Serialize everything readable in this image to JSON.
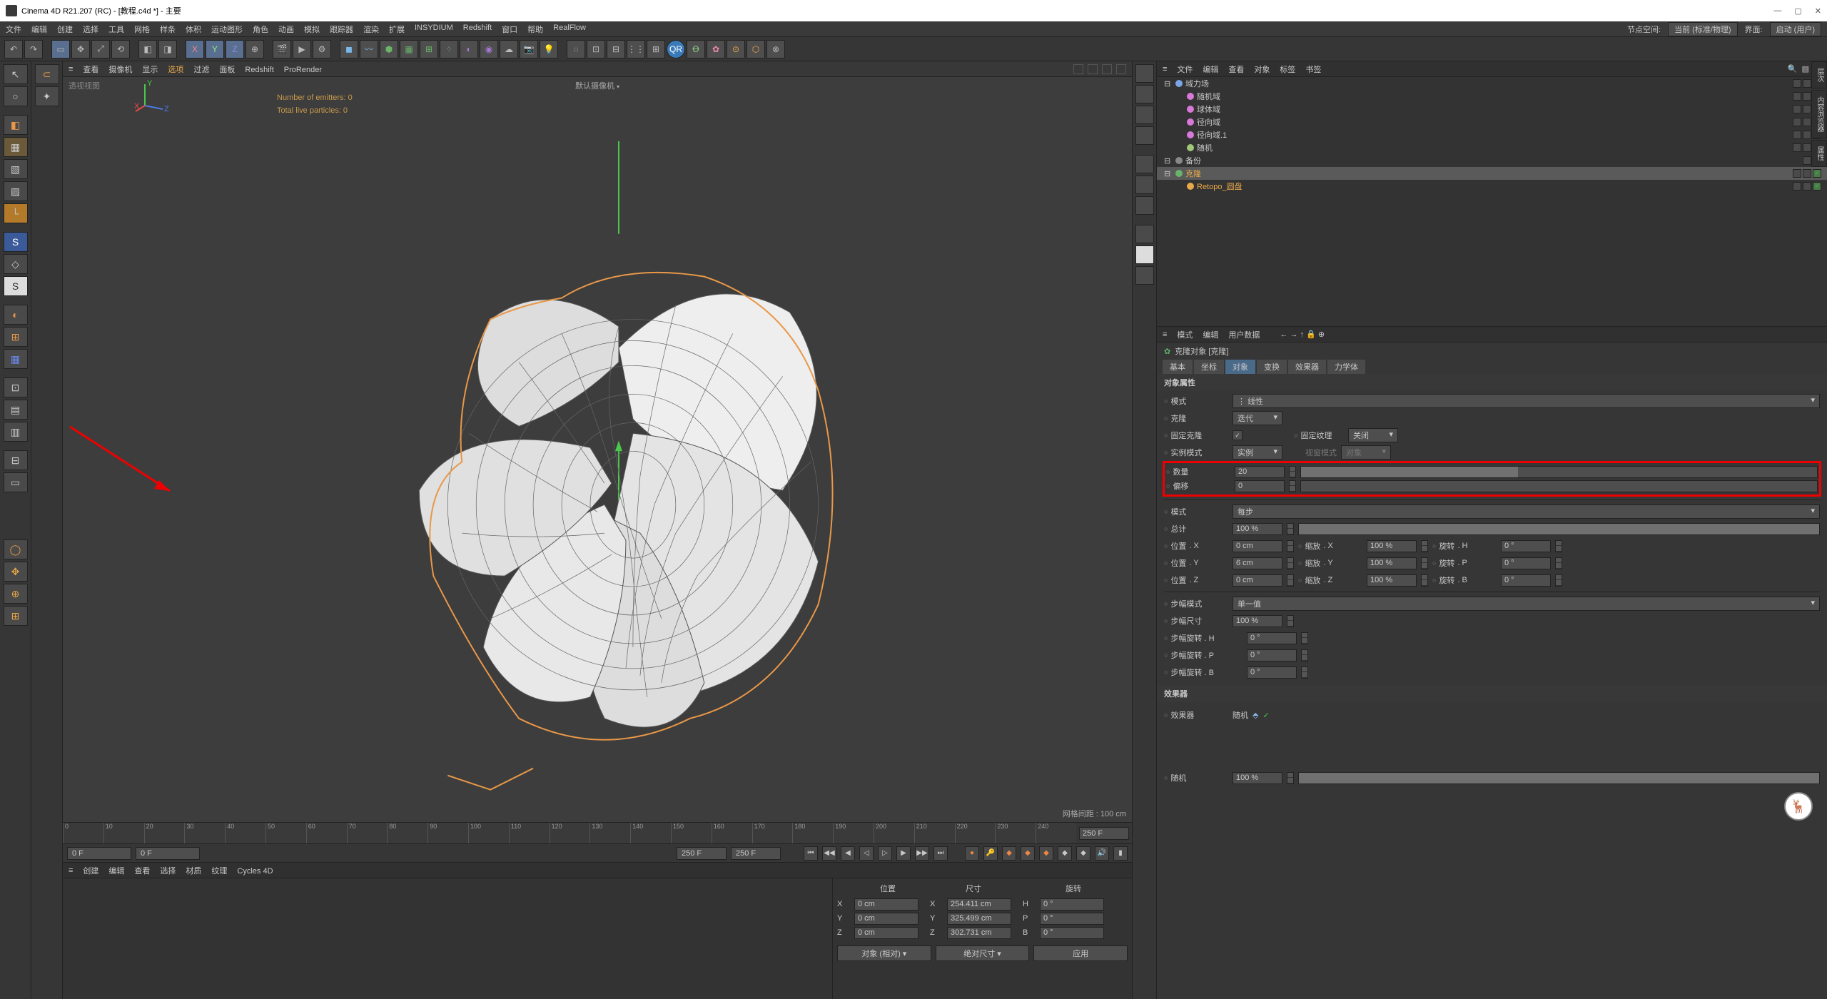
{
  "app": {
    "title": "Cinema 4D R21.207 (RC) - [教程.c4d *] - 主要",
    "node_space_label": "节点空间:",
    "node_space_value": "当前 (标准/物理)",
    "layout_label": "界面:",
    "layout_value": "启动 (用户)"
  },
  "menu": {
    "items": [
      "文件",
      "编辑",
      "创建",
      "选择",
      "工具",
      "网格",
      "样条",
      "体积",
      "运动图形",
      "角色",
      "动画",
      "模拟",
      "跟踪器",
      "渲染",
      "扩展",
      "INSYDIUM",
      "Redshift",
      "窗口",
      "帮助",
      "RealFlow"
    ]
  },
  "viewbar": {
    "items": [
      "查看",
      "摄像机",
      "显示",
      "选项",
      "过滤",
      "面板",
      "Redshift",
      "ProRender"
    ],
    "active_index": 3
  },
  "viewport": {
    "label": "透视视图",
    "emitters": "Number of emitters: 0",
    "particles": "Total live particles: 0",
    "camera": "默认摄像机",
    "grid": "网格间距 : 100 cm"
  },
  "timeline": {
    "start": "0 F",
    "current": "0 F",
    "end1": "250 F",
    "end2": "250 F",
    "total": "250 F",
    "ticks": [
      0,
      10,
      20,
      30,
      40,
      50,
      60,
      70,
      80,
      90,
      100,
      110,
      120,
      130,
      140,
      150,
      160,
      170,
      180,
      190,
      200,
      210,
      220,
      230,
      240
    ]
  },
  "matbar": {
    "items": [
      "创建",
      "编辑",
      "查看",
      "选择",
      "材质",
      "纹理",
      "Cycles 4D"
    ]
  },
  "coords": {
    "headers": [
      "位置",
      "尺寸",
      "旋转"
    ],
    "rows": [
      {
        "axis": "X",
        "pos": "0 cm",
        "size": "254.411 cm",
        "rot": "H",
        "rotv": "0 °"
      },
      {
        "axis": "Y",
        "pos": "0 cm",
        "size": "325.499 cm",
        "rot": "P",
        "rotv": "0 °"
      },
      {
        "axis": "Z",
        "pos": "0 cm",
        "size": "302.731 cm",
        "rot": "B",
        "rotv": "0 °"
      }
    ],
    "mode1": "对象 (相对)",
    "mode2": "绝对尺寸",
    "apply": "应用"
  },
  "objpanel": {
    "tabs": [
      "文件",
      "编辑",
      "查看",
      "对象",
      "标签",
      "书签"
    ],
    "tree": [
      {
        "indent": 0,
        "icon": "#7aa6e8",
        "name": "域力场",
        "sel": false,
        "tags": 3
      },
      {
        "indent": 1,
        "icon": "#d878d8",
        "name": "随机域",
        "sel": false,
        "tags": 3
      },
      {
        "indent": 1,
        "icon": "#d878d8",
        "name": "球体域",
        "sel": false,
        "tags": 3
      },
      {
        "indent": 1,
        "icon": "#d878d8",
        "name": "径向域",
        "sel": false,
        "tags": 3
      },
      {
        "indent": 1,
        "icon": "#d878d8",
        "name": "径向域.1",
        "sel": false,
        "tags": 3
      },
      {
        "indent": 1,
        "icon": "#a0c878",
        "name": "随机",
        "sel": false,
        "tags": 3
      },
      {
        "indent": 0,
        "icon": "#888",
        "name": "备份",
        "sel": false,
        "tags": 2
      },
      {
        "indent": 0,
        "icon": "#6ab46a",
        "name": "克隆",
        "sel": true,
        "tags": 3
      },
      {
        "indent": 1,
        "icon": "#e8a94a",
        "name": "Retopo_圆盘",
        "sel": false,
        "tags": 3,
        "retopo": true
      }
    ]
  },
  "attr": {
    "tabs": [
      "模式",
      "编辑",
      "用户数据"
    ],
    "title": "克隆对象 [克隆]",
    "subtabs": [
      "基本",
      "坐标",
      "对象",
      "变换",
      "效果器",
      "力学体"
    ],
    "subtab_active": 2,
    "section": "对象属性",
    "mode_label": "模式",
    "mode_value": "线性",
    "clone_label": "克隆",
    "clone_value": "迭代",
    "fixclone_label": "固定克隆",
    "fixclone_checked": true,
    "fixtex_label": "固定纹理",
    "fixtex_value": "关闭",
    "instmode_label": "实例模式",
    "instmode_value": "实例",
    "viewmode_label": "视窗模式",
    "viewmode_value": "对象",
    "count_label": "数量",
    "count_value": "20",
    "offset_label": "偏移",
    "offset_value": "0",
    "mode2_label": "模式",
    "mode2_value": "每步",
    "total_label": "总计",
    "total_value": "100 %",
    "pos": {
      "x": "0 cm",
      "y": "6 cm",
      "z": "0 cm"
    },
    "scale": {
      "x": "100 %",
      "y": "100 %",
      "z": "100 %"
    },
    "rot": {
      "h": "0 °",
      "p": "0 °",
      "b": "0 °"
    },
    "pos_label": "位置",
    "scale_label": "缩放",
    "rot_label": "旋转",
    "stepmode_label": "步幅模式",
    "stepmode_value": "单一值",
    "stepsize_label": "步幅尺寸",
    "stepsize_value": "100 %",
    "steprot_labels": [
      "步幅旋转 . H",
      "步幅旋转 . P",
      "步幅旋转 . B"
    ],
    "steprot_values": [
      "0 °",
      "0 °",
      "0 °"
    ],
    "effectors_section": "效果器",
    "effector_label": "效果器",
    "effector_value": "随机",
    "random_label": "随机",
    "random_value": "100 %"
  }
}
